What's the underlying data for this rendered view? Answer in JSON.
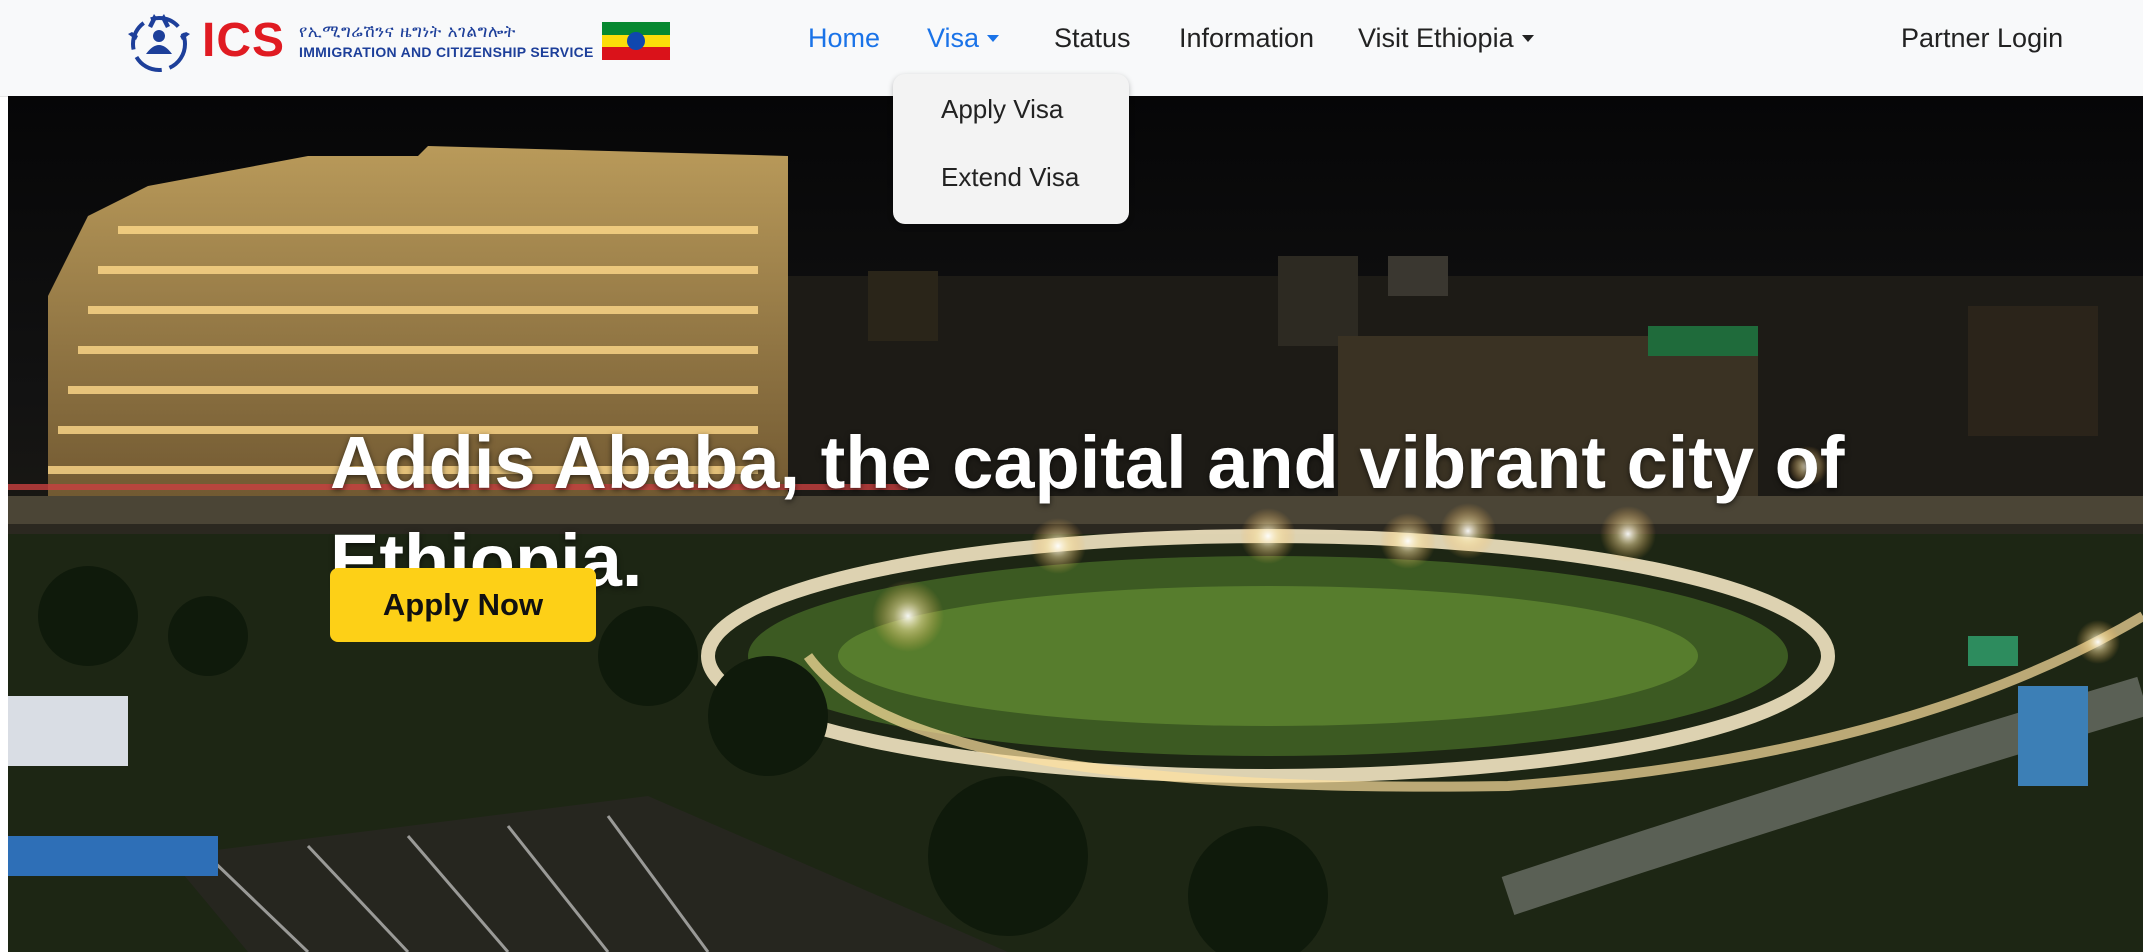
{
  "brand": {
    "logo_text": "ICS",
    "subtitle_amharic": "የኢሚግሬሽንና ዜግነት አገልግሎት",
    "subtitle_english": "IMMIGRATION AND CITIZENSHIP SERVICE"
  },
  "nav": {
    "items": [
      {
        "label": "Home",
        "active": true
      },
      {
        "label": "Visa",
        "dropdown": true
      },
      {
        "label": "Status"
      },
      {
        "label": "Information"
      },
      {
        "label": "Visit Ethiopia",
        "dropdown": true
      }
    ],
    "partner_login": "Partner Login"
  },
  "visa_dropdown": {
    "items": [
      "Apply Visa",
      "Extend Visa"
    ]
  },
  "hero": {
    "title": "Addis Ababa, the capital and vibrant city of Ethiopia.",
    "cta_label": "Apply Now"
  },
  "colors": {
    "active_link": "#1a73e8",
    "logo_red": "#e01b22",
    "logo_blue": "#1d3f9a",
    "cta_yellow": "#fdd017",
    "navbar_bg": "#f8f9fa"
  },
  "icons": {
    "logo": "ics-logo-icon",
    "flag": "ethiopia-flag-icon",
    "dropdown": "caret-down-icon"
  }
}
